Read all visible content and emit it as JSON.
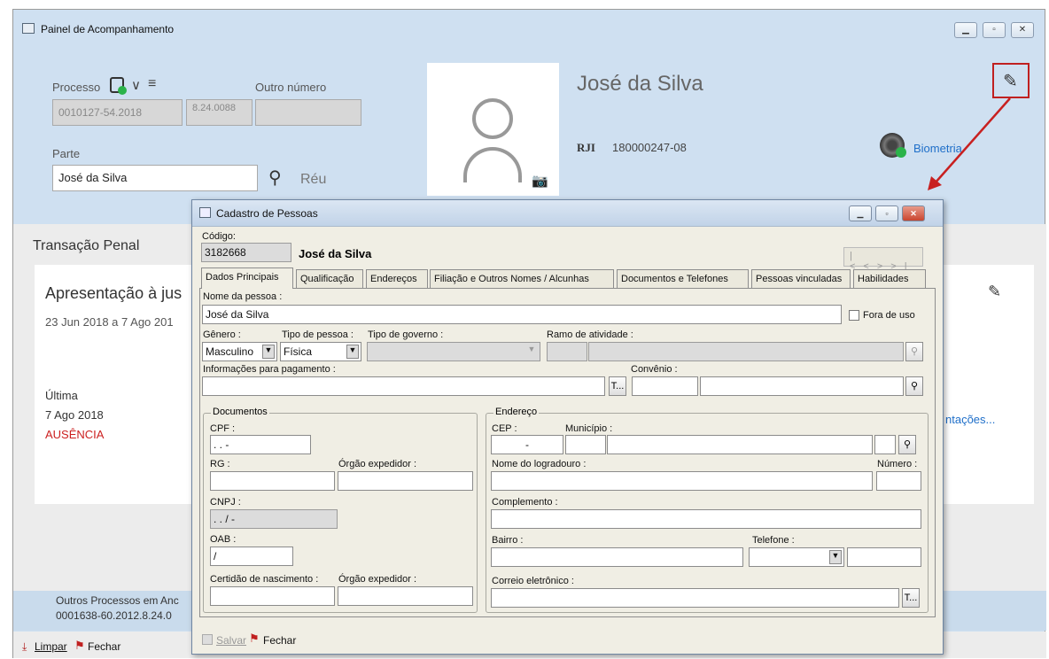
{
  "main": {
    "title": "Painel de Acompanhamento",
    "processo_label": "Processo",
    "outro_numero_label": "Outro número",
    "processo_value": "0010127-54.2018",
    "processo_code": "8.24.0088",
    "parte_label": "Parte",
    "parte_value": "José da Silva",
    "parte_role": "Réu",
    "person_name": "José da Silva",
    "rji_label": "RJI",
    "rji_value": "180000247-08",
    "biometria": "Biometria",
    "section_title": "Transação Penal",
    "card_title": "Apresentação à jus",
    "card_dates": "23 Jun 2018 a 7 Ago 201",
    "ultima_label": "Última",
    "ultima_date": "7 Ago 2018",
    "ultima_status": "AUSÊNCIA",
    "more_link": "ntações...",
    "outros_label": "Outros Processos em Anc",
    "outros_value": "0001638-60.2012.8.24.0",
    "limpar": "Limpar",
    "fechar": "Fechar"
  },
  "dialog": {
    "title": "Cadastro de Pessoas",
    "codigo_label": "Código:",
    "codigo_value": "3182668",
    "name_display": "José da Silva",
    "tabs": [
      {
        "label": "Dados Principais"
      },
      {
        "label": "Qualificação"
      },
      {
        "label": "Endereços"
      },
      {
        "label": "Filiação e Outros Nomes / Alcunhas"
      },
      {
        "label": "Documentos e Telefones"
      },
      {
        "label": "Pessoas vinculadas"
      },
      {
        "label": "Habilidades"
      }
    ],
    "nome_label": "Nome da pessoa :",
    "nome_value": "José da Silva",
    "fora_de_uso": "Fora de uso",
    "genero_label": "Gênero :",
    "genero_value": "Masculino",
    "tipo_pessoa_label": "Tipo de pessoa :",
    "tipo_pessoa_value": "Física",
    "tipo_governo_label": "Tipo de governo :",
    "ramo_label": "Ramo de atividade :",
    "info_pagamento_label": "Informações para pagamento :",
    "convenio_label": "Convênio :",
    "documentos": {
      "title": "Documentos",
      "cpf_label": "CPF :",
      "cpf_mask": ". . -",
      "rg_label": "RG :",
      "orgao_label": "Órgão expedidor :",
      "cnpj_label": "CNPJ :",
      "cnpj_mask": ". . / -",
      "oab_label": "OAB :",
      "oab_mask": "/",
      "certidao_label": "Certidão de nascimento :",
      "orgao2_label": "Órgão expedidor :"
    },
    "endereco": {
      "title": "Endereço",
      "cep_label": "CEP :",
      "cep_mask": "-",
      "municipio_label": "Município :",
      "logradouro_label": "Nome do logradouro :",
      "numero_label": "Número :",
      "complemento_label": "Complemento :",
      "bairro_label": "Bairro :",
      "telefone_label": "Telefone :",
      "email_label": "Correio eletrônico :"
    },
    "salvar": "Salvar",
    "fechar": "Fechar"
  },
  "colors": {
    "accent": "#1f6fc9",
    "red": "#cc2020",
    "panel": "#cfe0f1",
    "dialog": "#f0eee4"
  }
}
